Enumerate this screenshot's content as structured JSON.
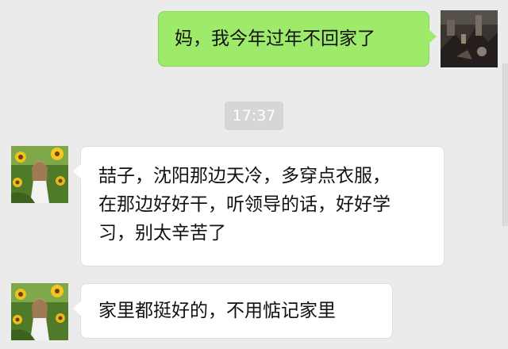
{
  "chat": {
    "timestamp": "17:37",
    "messages": [
      {
        "sender": "self",
        "lines": [
          "妈，我今年过年不回家了"
        ]
      },
      {
        "sender": "contact",
        "lines": [
          "喆子，沈阳那边天冷，多穿点衣服，",
          "在那边好好干，听领导的话，好好学",
          "习，别太辛苦了"
        ]
      },
      {
        "sender": "contact",
        "lines": [
          "家里都挺好的，不用惦记家里"
        ]
      }
    ]
  },
  "colors": {
    "background": "#ebebeb",
    "outgoing_bubble": "#9eea6a",
    "incoming_bubble": "#ffffff",
    "timestamp_badge": "#d6d6d6"
  }
}
